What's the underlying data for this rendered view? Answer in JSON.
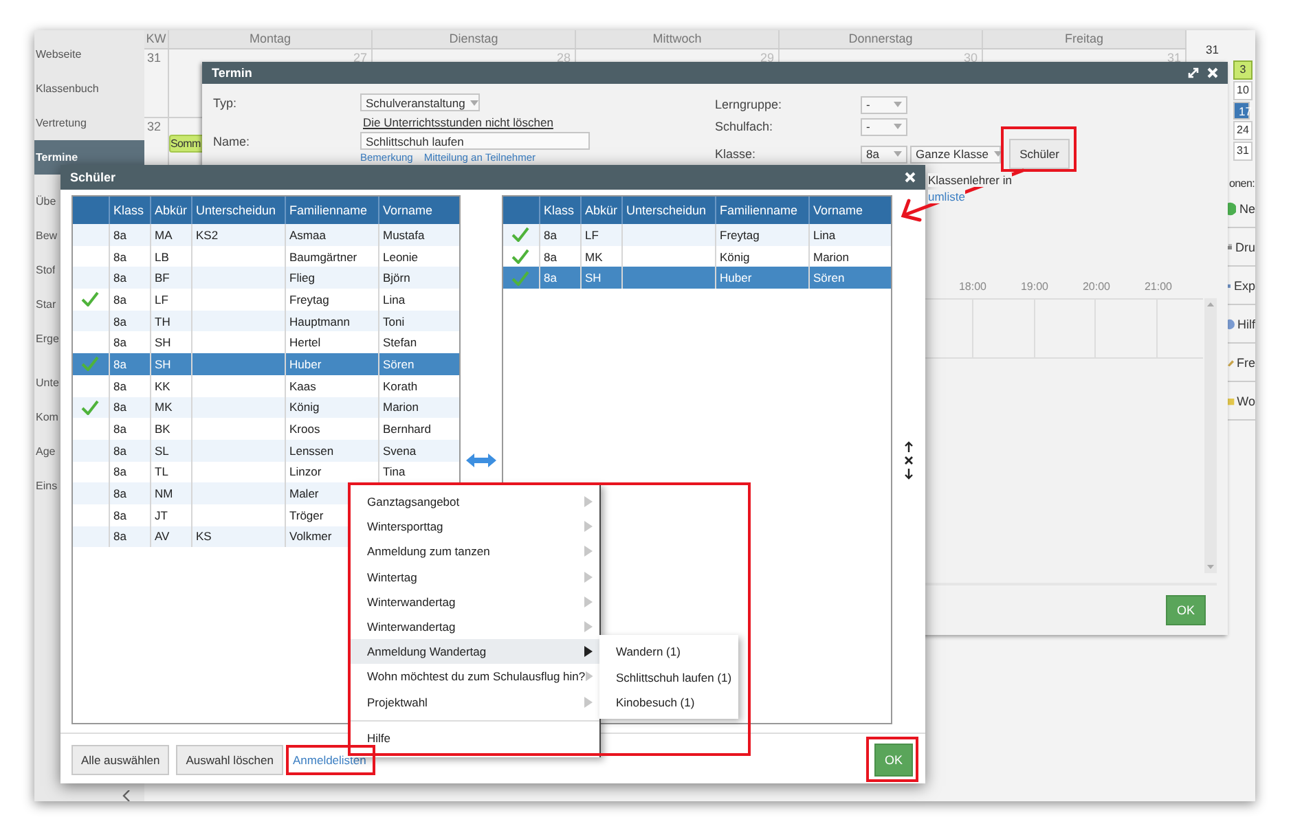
{
  "app": {
    "sidebar": {
      "groups": [
        {
          "items": [
            {
              "label": "Webseite",
              "selected": false
            },
            {
              "label": "Klassenbuch",
              "selected": false
            },
            {
              "label": "Vertretung",
              "selected": false
            },
            {
              "label": "Termine",
              "selected": true
            }
          ]
        },
        {
          "items": [
            {
              "label": "Übe",
              "selected": false
            },
            {
              "label": "Bew",
              "selected": false
            },
            {
              "label": "Stof",
              "selected": false
            },
            {
              "label": "Star",
              "selected": false
            },
            {
              "label": "Erge",
              "selected": false
            }
          ]
        },
        {
          "items": [
            {
              "label": "Unte",
              "selected": false
            },
            {
              "label": "Kom",
              "selected": false
            },
            {
              "label": "Age",
              "selected": false
            },
            {
              "label": "Eins",
              "selected": false
            }
          ]
        }
      ]
    },
    "calendar": {
      "kw_header": "KW",
      "days": [
        "Montag",
        "Dienstag",
        "Mittwoch",
        "Donnerstag",
        "Freitag"
      ],
      "weeks": [
        {
          "week": "31",
          "dates": [
            "27",
            "28",
            "29",
            "30",
            "31"
          ]
        },
        {
          "week": "32",
          "events": [
            {
              "label": "Somm"
            }
          ]
        }
      ]
    },
    "side_panel": {
      "month_label": "31",
      "mini_days": [
        {
          "label": "3",
          "highlighted": true,
          "selected": false
        },
        {
          "label": "10",
          "highlighted": false,
          "selected": false
        },
        {
          "label": "17",
          "highlighted": false,
          "selected": true
        },
        {
          "label": "24",
          "highlighted": false,
          "selected": false
        },
        {
          "label": "31",
          "highlighted": false,
          "selected": false
        }
      ],
      "heading": "onen:",
      "actions": [
        "Ne",
        "Dru",
        "Exp",
        "Hilf",
        "Fre",
        "Wo"
      ]
    }
  },
  "termin_dialog": {
    "title": "Termin",
    "typ": {
      "label": "Typ:",
      "value": "Schulveranstaltung"
    },
    "keep_lessons_link": "Die Unterrichtsstunden nicht löschen",
    "name": {
      "label": "Name:",
      "value": "Schlittschuh laufen"
    },
    "links": [
      "Bemerkung",
      "Mitteilung an Teilnehmer"
    ],
    "lerngruppe": {
      "label": "Lerngruppe:",
      "value": "-"
    },
    "schulfach": {
      "label": "Schulfach:",
      "value": "-"
    },
    "klasse": {
      "label": "Klasse:",
      "value": "8a",
      "scope": "Ganze Klasse"
    },
    "students_button": "Schüler",
    "class_teacher_label": "Klassenlehrer in",
    "list_link": "umliste",
    "time_labels": [
      "18:00",
      "19:00",
      "20:00",
      "21:00"
    ],
    "ok_button": "OK"
  },
  "schueler_dialog": {
    "title": "Schüler",
    "available": {
      "columns": [
        "Klass",
        "Abkür",
        "Unterscheidun",
        "Familienname",
        "Vorname"
      ],
      "rows": [
        {
          "klasse": "8a",
          "kuerzel": "MA",
          "unterscheidung": "KS2",
          "familienname": "Asmaa",
          "vorname": "Mustafa",
          "checked": false,
          "selected": false
        },
        {
          "klasse": "8a",
          "kuerzel": "LB",
          "familienname": "Baumgärtner",
          "vorname": "Leonie",
          "checked": false,
          "selected": false
        },
        {
          "klasse": "8a",
          "kuerzel": "BF",
          "familienname": "Flieg",
          "vorname": "Björn",
          "checked": false,
          "selected": false
        },
        {
          "klasse": "8a",
          "kuerzel": "LF",
          "familienname": "Freytag",
          "vorname": "Lina",
          "checked": true,
          "selected": false
        },
        {
          "klasse": "8a",
          "kuerzel": "TH",
          "familienname": "Hauptmann",
          "vorname": "Toni",
          "checked": false,
          "selected": false
        },
        {
          "klasse": "8a",
          "kuerzel": "SH",
          "familienname": "Hertel",
          "vorname": "Stefan",
          "checked": false,
          "selected": false
        },
        {
          "klasse": "8a",
          "kuerzel": "SH",
          "familienname": "Huber",
          "vorname": "Sören",
          "checked": true,
          "selected": true
        },
        {
          "klasse": "8a",
          "kuerzel": "KK",
          "familienname": "Kaas",
          "vorname": "Korath",
          "checked": false,
          "selected": false
        },
        {
          "klasse": "8a",
          "kuerzel": "MK",
          "familienname": "König",
          "vorname": "Marion",
          "checked": true,
          "selected": false
        },
        {
          "klasse": "8a",
          "kuerzel": "BK",
          "familienname": "Kroos",
          "vorname": "Bernhard",
          "checked": false,
          "selected": false
        },
        {
          "klasse": "8a",
          "kuerzel": "SL",
          "familienname": "Lenssen",
          "vorname": "Svena",
          "checked": false,
          "selected": false
        },
        {
          "klasse": "8a",
          "kuerzel": "TL",
          "familienname": "Linzor",
          "vorname": "Tina",
          "checked": false,
          "selected": false
        },
        {
          "klasse": "8a",
          "kuerzel": "NM",
          "familienname": "Maler",
          "checked": false,
          "selected": false
        },
        {
          "klasse": "8a",
          "kuerzel": "JT",
          "familienname": "Tröger",
          "checked": false,
          "selected": false
        },
        {
          "klasse": "8a",
          "kuerzel": "AV",
          "unterscheidung": "KS",
          "familienname": "Volkmer",
          "checked": false,
          "selected": false
        }
      ]
    },
    "chosen": {
      "columns": [
        "Klass",
        "Abkür",
        "Unterscheidun",
        "Familienname",
        "Vorname"
      ],
      "rows": [
        {
          "klasse": "8a",
          "kuerzel": "LF",
          "familienname": "Freytag",
          "vorname": "Lina",
          "checked": true,
          "selected": false
        },
        {
          "klasse": "8a",
          "kuerzel": "MK",
          "familienname": "König",
          "vorname": "Marion",
          "checked": true,
          "selected": false
        },
        {
          "klasse": "8a",
          "kuerzel": "SH",
          "familienname": "Huber",
          "vorname": "Sören",
          "checked": true,
          "selected": true
        }
      ]
    },
    "footer_buttons": [
      "Alle auswählen",
      "Auswahl löschen"
    ],
    "lists_link": "Anmeldelisten",
    "ok_button": "OK"
  },
  "context_menu": {
    "items": [
      {
        "label": "Ganztagsangebot",
        "kind": "submenu",
        "expanded": false
      },
      {
        "label": "Wintersporttag",
        "kind": "submenu",
        "expanded": false
      },
      {
        "label": "Anmeldung zum tanzen",
        "kind": "submenu",
        "expanded": false
      },
      {
        "label": "Wintertag",
        "kind": "submenu",
        "expanded": false
      },
      {
        "label": "Winterwandertag",
        "kind": "submenu",
        "expanded": false
      },
      {
        "label": "Winterwandertag",
        "kind": "submenu",
        "expanded": false
      },
      {
        "label": "Anmeldung Wandertag",
        "kind": "submenu",
        "expanded": true
      },
      {
        "label": "Wohn möchtest du zum Schulausflug hin?",
        "kind": "submenu",
        "expanded": false
      },
      {
        "label": "Projektwahl",
        "kind": "submenu",
        "expanded": false
      },
      {
        "label": "Hilfe",
        "kind": "action",
        "expanded": false
      }
    ],
    "submenu": [
      "Wandern (1)",
      "Schlittschuh laufen (1)",
      "Kinobesuch (1)"
    ]
  }
}
